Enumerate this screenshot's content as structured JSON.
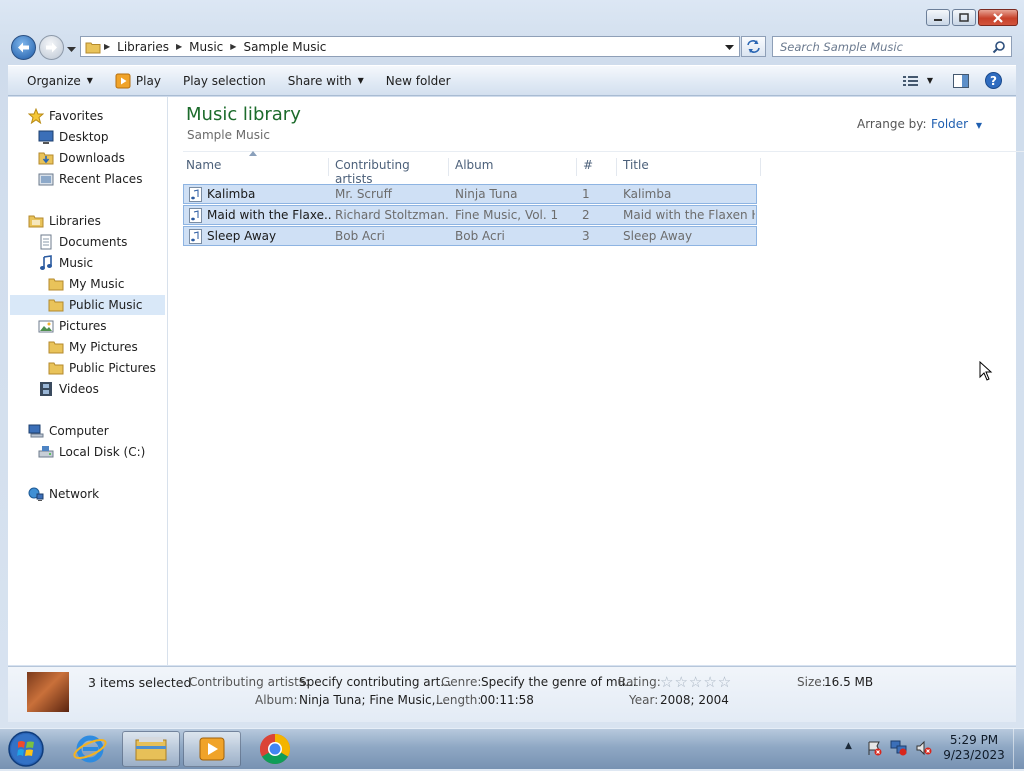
{
  "window": {
    "nav": {
      "breadcrumb": [
        "Libraries",
        "Music",
        "Sample Music"
      ],
      "search_placeholder": "Search Sample Music"
    },
    "toolbar": {
      "organize": "Organize",
      "play": "Play",
      "play_selection": "Play selection",
      "share_with": "Share with",
      "new_folder": "New folder"
    },
    "sidebar": {
      "favorites": "Favorites",
      "desktop": "Desktop",
      "downloads": "Downloads",
      "recent_places": "Recent Places",
      "libraries": "Libraries",
      "documents": "Documents",
      "music": "Music",
      "my_music": "My Music",
      "public_music": "Public Music",
      "pictures": "Pictures",
      "my_pictures": "My Pictures",
      "public_pictures": "Public Pictures",
      "videos": "Videos",
      "computer": "Computer",
      "local_disk": "Local Disk (C:)",
      "network": "Network"
    },
    "library": {
      "title": "Music library",
      "subtitle": "Sample Music",
      "arrange_label": "Arrange by:",
      "arrange_value": "Folder"
    },
    "columns": [
      "Name",
      "Contributing artists",
      "Album",
      "#",
      "Title"
    ],
    "files": [
      {
        "name": "Kalimba",
        "artists": "Mr. Scruff",
        "album": "Ninja Tuna",
        "num": "1",
        "title": "Kalimba"
      },
      {
        "name": "Maid with the Flaxe...",
        "artists": "Richard Stoltzman...",
        "album": "Fine Music, Vol. 1",
        "num": "2",
        "title": "Maid with the Flaxen H..."
      },
      {
        "name": "Sleep Away",
        "artists": "Bob Acri",
        "album": "Bob Acri",
        "num": "3",
        "title": "Sleep Away"
      }
    ],
    "details": {
      "count": "3 items selected",
      "artists_label": "Contributing artists:",
      "artists_value": "Specify contributing art...",
      "genre_label": "Genre:",
      "genre_value": "Specify the genre of mu...",
      "rating_label": "Rating:",
      "rating_stars": 0,
      "size_label": "Size:",
      "size_value": "16.5 MB",
      "album_label": "Album:",
      "album_value": "Ninja Tuna; Fine Music,...",
      "length_label": "Length:",
      "length_value": "00:11:58",
      "year_label": "Year:",
      "year_value": "2008; 2004"
    }
  },
  "taskbar": {
    "clock_time": "5:29 PM",
    "clock_date": "9/23/2023"
  },
  "colors": {
    "title_green": "#1c6b2b",
    "selection_fill": "#cfe0f5",
    "selection_border": "#8eb4e2",
    "link_blue": "#1f5fb0"
  }
}
